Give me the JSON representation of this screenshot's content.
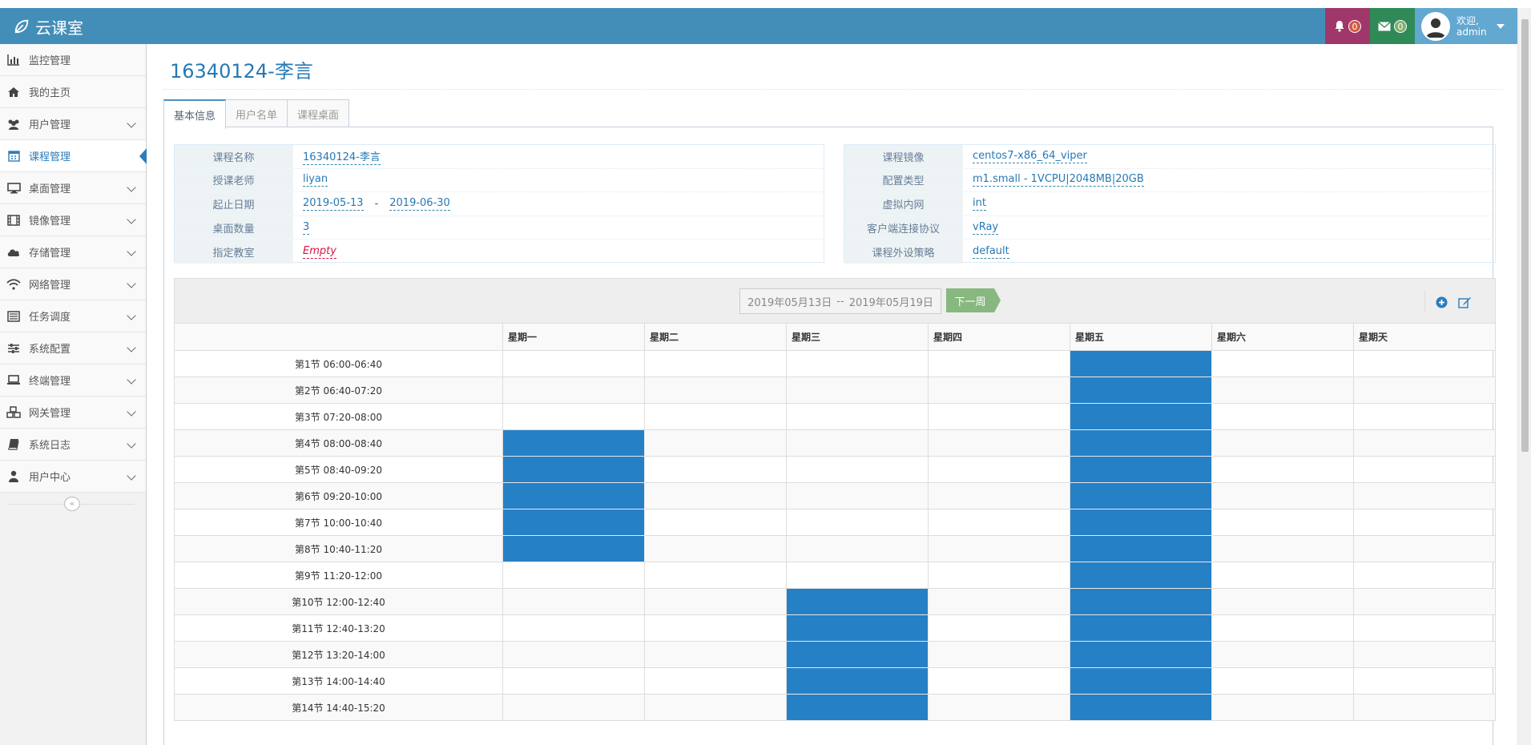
{
  "app": {
    "brand": "云课室"
  },
  "navbar": {
    "notifications_count": "0",
    "messages_count": "0",
    "greeting": "欢迎,",
    "username": "admin"
  },
  "sidebar": {
    "items": [
      {
        "label": "监控管理",
        "icon": "bar-chart-icon"
      },
      {
        "label": "我的主页",
        "icon": "home-icon"
      },
      {
        "label": "用户管理",
        "icon": "users-icon"
      },
      {
        "label": "课程管理",
        "icon": "calendar-icon",
        "active": true
      },
      {
        "label": "桌面管理",
        "icon": "desktop-icon"
      },
      {
        "label": "镜像管理",
        "icon": "film-icon"
      },
      {
        "label": "存储管理",
        "icon": "cloud-icon"
      },
      {
        "label": "网络管理",
        "icon": "wifi-icon"
      },
      {
        "label": "任务调度",
        "icon": "list-icon"
      },
      {
        "label": "系统配置",
        "icon": "sliders-icon"
      },
      {
        "label": "终端管理",
        "icon": "laptop-icon"
      },
      {
        "label": "网关管理",
        "icon": "cubes-icon"
      },
      {
        "label": "系统日志",
        "icon": "book-icon"
      },
      {
        "label": "用户中心",
        "icon": "user-icon"
      }
    ]
  },
  "page": {
    "title": "16340124-李言",
    "tabs": [
      "基本信息",
      "用户名单",
      "课程桌面"
    ]
  },
  "info_left": {
    "course_name_label": "课程名称",
    "course_name": "16340124-李言",
    "teacher_label": "授课老师",
    "teacher": "liyan",
    "dates_label": "起止日期",
    "start_date": "2019-05-13",
    "date_sep": "-",
    "end_date": "2019-06-30",
    "desktop_count_label": "桌面数量",
    "desktop_count": "3",
    "classroom_label": "指定教室",
    "classroom": "Empty"
  },
  "info_right": {
    "image_label": "课程镜像",
    "image": "centos7-x86_64_viper",
    "flavor_label": "配置类型",
    "flavor": "m1.small - 1VCPU|2048MB|20GB",
    "network_label": "虚拟内网",
    "network": "int",
    "protocol_label": "客户端连接协议",
    "protocol": "vRay",
    "policy_label": "课程外设策略",
    "policy": "default"
  },
  "schedule": {
    "range_start": "2019年05月13日",
    "range_sep": "--",
    "range_end": "2019年05月19日",
    "next_week_label": "下一周",
    "days": [
      "星期一",
      "星期二",
      "星期三",
      "星期四",
      "星期五",
      "星期六",
      "星期天"
    ],
    "slots": [
      "第1节 06:00-06:40",
      "第2节 06:40-07:20",
      "第3节 07:20-08:00",
      "第4节 08:00-08:40",
      "第5节 08:40-09:20",
      "第6节 09:20-10:00",
      "第7节 10:00-10:40",
      "第8节 10:40-11:20",
      "第9节 11:20-12:00",
      "第10节 12:00-12:40",
      "第11节 12:40-13:20",
      "第12节 13:20-14:00",
      "第13节 14:00-14:40",
      "第14节 14:40-15:20"
    ],
    "booked": {
      "星期一": [
        4,
        5,
        6,
        7,
        8
      ],
      "星期三": [
        10,
        11,
        12,
        13,
        14
      ],
      "星期五": [
        1,
        2,
        3,
        4,
        5,
        6,
        7,
        8,
        9,
        10,
        11,
        12,
        13,
        14
      ]
    },
    "booked_color": "#2680c5"
  }
}
